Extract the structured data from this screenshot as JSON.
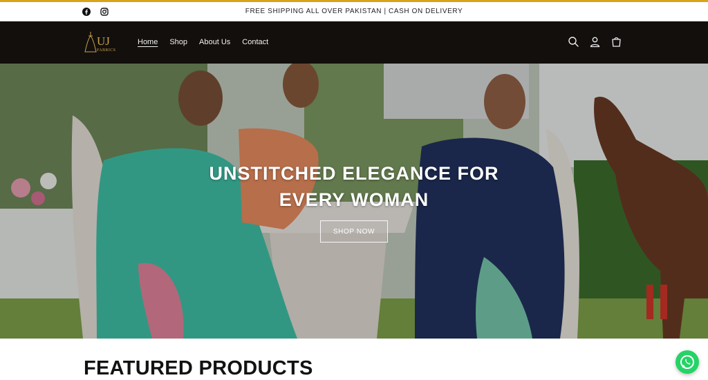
{
  "announcement": {
    "text": "FREE SHIPPING ALL OVER PAKISTAN | CASH ON DELIVERY",
    "socials": [
      "facebook-icon",
      "instagram-icon"
    ]
  },
  "header": {
    "logo_text": "UJ",
    "logo_subtext": "FABRICS",
    "nav": [
      {
        "label": "Home",
        "active": true
      },
      {
        "label": "Shop",
        "active": false
      },
      {
        "label": "About Us",
        "active": false
      },
      {
        "label": "Contact",
        "active": false
      }
    ],
    "icons": [
      "search-icon",
      "account-icon",
      "cart-icon"
    ]
  },
  "hero": {
    "headline": "UNSTITCHED ELEGANCE FOR EVERY WOMAN",
    "cta": "SHOP NOW"
  },
  "featured": {
    "title": "FEATURED PRODUCTS"
  },
  "colors": {
    "accent": "#d9a41a",
    "header_bg": "#120f0d",
    "whatsapp": "#25d366"
  }
}
